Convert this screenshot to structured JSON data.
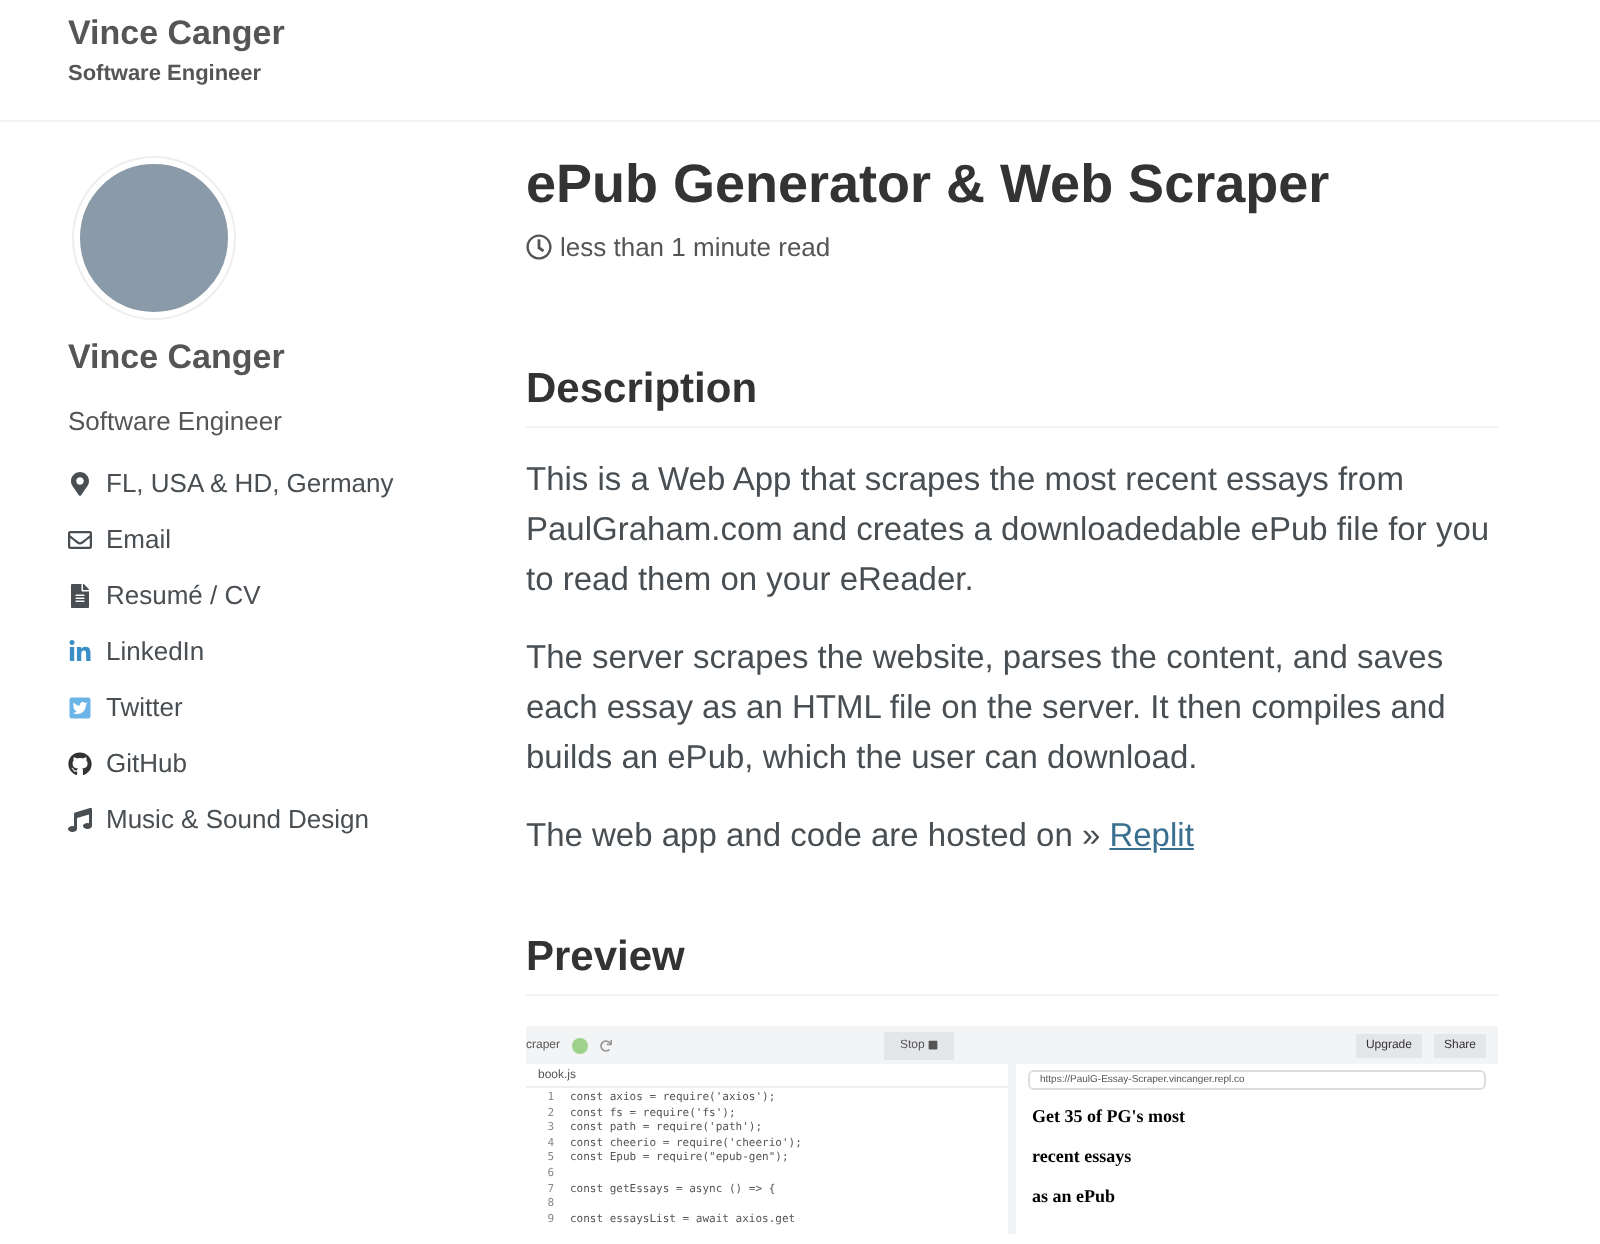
{
  "masthead": {
    "title": "Vince Canger",
    "subtitle": "Software Engineer"
  },
  "sidebar": {
    "name": "Vince Canger",
    "bio": "Software Engineer",
    "links": [
      {
        "kind": "location",
        "label": "FL, USA & HD, Germany"
      },
      {
        "kind": "email",
        "label": "Email"
      },
      {
        "kind": "document",
        "label": "Resumé / CV"
      },
      {
        "kind": "linkedin",
        "label": "LinkedIn"
      },
      {
        "kind": "twitter",
        "label": "Twitter"
      },
      {
        "kind": "github",
        "label": "GitHub"
      },
      {
        "kind": "music",
        "label": "Music & Sound Design"
      }
    ]
  },
  "article": {
    "title": "ePub Generator & Web Scraper",
    "read_time": "less than 1 minute read",
    "sections": [
      {
        "heading": "Description",
        "paragraphs": [
          {
            "text": "This is a Web App that scrapes the most recent essays from PaulGraham.com and creates a downloadedable ePub file for you to read them on your eReader."
          },
          {
            "text": "The server scrapes the website, parses the content, and saves each essay as an HTML file on the server. It then compiles and builds an ePub, which the user can download."
          },
          {
            "text": "The web app and code are hosted on » ",
            "link": "Replit"
          }
        ]
      },
      {
        "heading": "Preview"
      }
    ]
  },
  "preview": {
    "app_name": "craper",
    "stop": "Stop",
    "upgrade": "Upgrade",
    "share": "Share",
    "file_tab": "book.js",
    "url": "https://PaulG-Essay-Scraper.vincanger.repl.co",
    "code": [
      {
        "n": "1",
        "line": "const axios = require('axios');"
      },
      {
        "n": "2",
        "line": "const fs = require('fs');"
      },
      {
        "n": "3",
        "line": "const path = require('path');"
      },
      {
        "n": "4",
        "line": "const cheerio = require('cheerio');"
      },
      {
        "n": "5",
        "line": "const Epub = require(\"epub-gen\");"
      },
      {
        "n": "6"
      },
      {
        "n": "7",
        "line": "const getEssays = async () => {"
      },
      {
        "n": "8"
      },
      {
        "n": "9",
        "line": "  const essaysList = await axios.get"
      }
    ],
    "output_lines": [
      "Get 35 of PG's most",
      "recent essays",
      "as an ePub"
    ]
  }
}
